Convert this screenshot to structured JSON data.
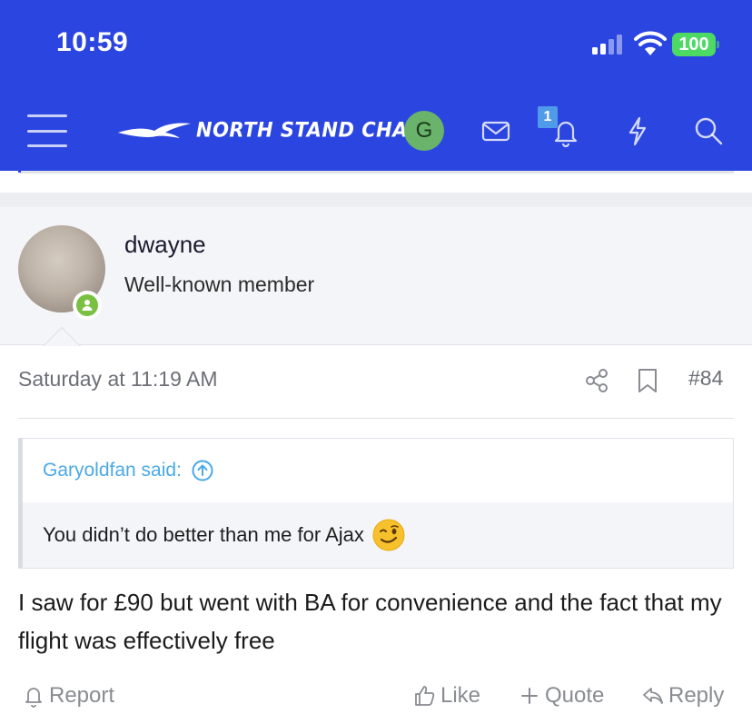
{
  "status_bar": {
    "time": "10:59",
    "battery": "100",
    "battery_color": "#4cd964"
  },
  "header": {
    "background": "#2b45e0",
    "logo_text": "NORTH STAND CHAT",
    "user_initial": "G",
    "notification_count": "1",
    "icons": [
      "menu-icon",
      "logo-bird-icon",
      "mail-icon",
      "bell-icon",
      "lightning-icon",
      "search-icon"
    ]
  },
  "user": {
    "name": "dwayne",
    "title": "Well-known member",
    "online_color": "#7ac143"
  },
  "post": {
    "date": "Saturday at 11:19 AM",
    "number": "#84",
    "quote": {
      "author": "Garyoldfan said:",
      "text": "You didn’t do better than me for Ajax"
    },
    "body": "I saw for £90 but went with BA for convenience and the fact that my flight was effectively free"
  },
  "actions": {
    "report": "Report",
    "like": "Like",
    "quote": "Quote",
    "reply": "Reply"
  }
}
